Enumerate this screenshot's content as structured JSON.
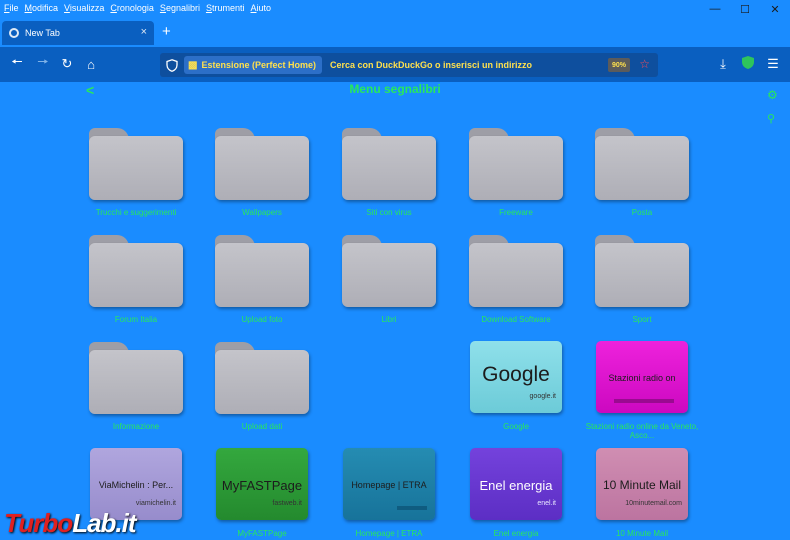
{
  "menubar": [
    "File",
    "Modifica",
    "Visualizza",
    "Cronologia",
    "Segnalibri",
    "Strumenti",
    "Aiuto"
  ],
  "tab": {
    "title": "New Tab",
    "close": "×"
  },
  "newtab": "+",
  "urlbar": {
    "extension_label": "Estensione (Perfect Home)",
    "placeholder": "Cerca con DuckDuckGo o inserisci un indirizzo",
    "zoom": "90%"
  },
  "page": {
    "title": "Menu segnalibri"
  },
  "folders": [
    "Trucchi e suggerimenti",
    "Wallpapers",
    "Siti con virus",
    "Freeware",
    "Posta",
    "Forum Italia",
    "Upload foto",
    "Libri",
    "Download Software",
    "Sport",
    "Informazione",
    "Upload dati"
  ],
  "sites": [
    {
      "name": "Google",
      "domain": "google.it",
      "label": "Google",
      "color": "#7fd6e0"
    },
    {
      "name": "Stazioni radio on",
      "domain": "",
      "label": "Stazioni radio online da Veneto, Asco...",
      "color": "#e010d0"
    },
    {
      "name": "ViaMichelin : Per...",
      "domain": "viamichelin.it",
      "label": "",
      "color": "#a89cd8"
    },
    {
      "name": "MyFASTPage",
      "domain": "fastweb.it",
      "label": "MyFASTPage",
      "color": "#2c9a36"
    },
    {
      "name": "Homepage | ETRA",
      "domain": "",
      "label": "Homepage | ETRA",
      "color": "#1e82a8"
    },
    {
      "name": "Enel energia",
      "domain": "enel.it",
      "label": "Enel energia",
      "color": "#6a3ad0"
    },
    {
      "name": "10 Minute Mail",
      "domain": "10minutemail.com",
      "label": "10 Minute Mail",
      "color": "#c880a8"
    }
  ],
  "watermark": {
    "part1": "Turbo",
    "part2": "Lab.it"
  }
}
